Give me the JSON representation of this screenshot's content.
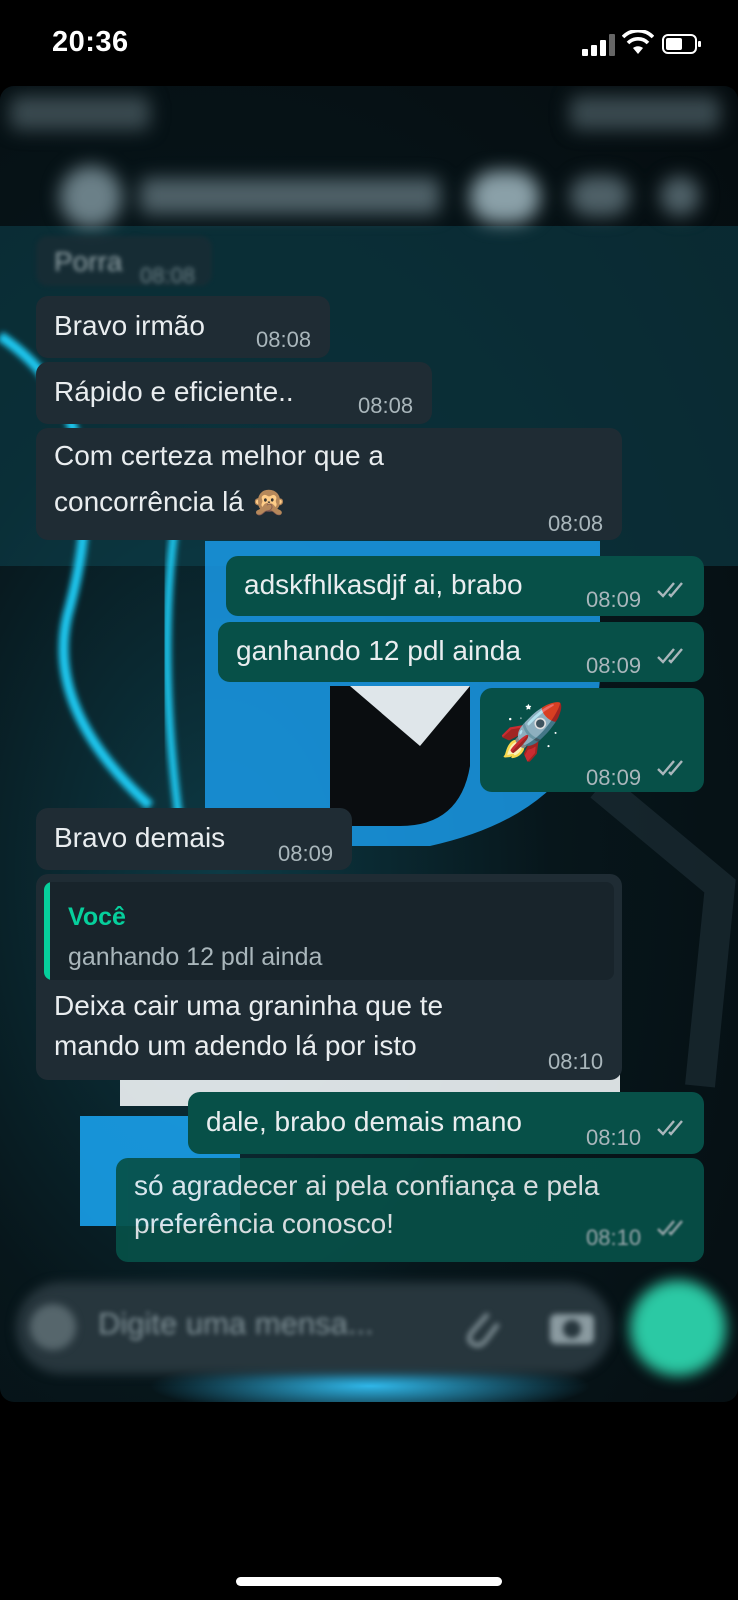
{
  "status_bar": {
    "time": "20:36"
  },
  "chat": {
    "messages": [
      {
        "id": "m0",
        "dir": "in",
        "text": "Porra",
        "time": "08:08"
      },
      {
        "id": "m1",
        "dir": "in",
        "text": "Bravo irmão",
        "time": "08:08"
      },
      {
        "id": "m2",
        "dir": "in",
        "text": "Rápido e eficiente..",
        "time": "08:08"
      },
      {
        "id": "m3",
        "dir": "in",
        "line1": "Com certeza melhor que a",
        "line2": "concorrência lá 🙊",
        "time": "08:08"
      },
      {
        "id": "m4",
        "dir": "out",
        "text": "adskfhlkasdjf ai, brabo",
        "time": "08:09",
        "status": "read"
      },
      {
        "id": "m5",
        "dir": "out",
        "text": "ganhando 12 pdl ainda",
        "time": "08:09",
        "status": "read"
      },
      {
        "id": "m6",
        "dir": "out",
        "text": "🚀",
        "time": "08:09",
        "status": "read"
      },
      {
        "id": "m7",
        "dir": "in",
        "text": "Bravo demais",
        "time": "08:09"
      },
      {
        "id": "m8",
        "dir": "in",
        "reply_author": "Você",
        "reply_text": "ganhando 12 pdl ainda",
        "line1": "Deixa cair uma graninha que te",
        "line2": "mando um adendo lá por isto",
        "time": "08:10"
      },
      {
        "id": "m9",
        "dir": "out",
        "text": "dale, brabo demais mano",
        "time": "08:10",
        "status": "read"
      },
      {
        "id": "m10",
        "dir": "out",
        "line1": "só agradecer ai pela confiança e pela",
        "line2": "preferência conosco!",
        "time": "08:10",
        "status": "read"
      }
    ]
  },
  "composer": {
    "placeholder": "Digite uma mensa..."
  },
  "colors": {
    "incoming": "#1f2c34",
    "outgoing": "#075048",
    "accent": "#06cf9c",
    "text": "#e9edef"
  }
}
